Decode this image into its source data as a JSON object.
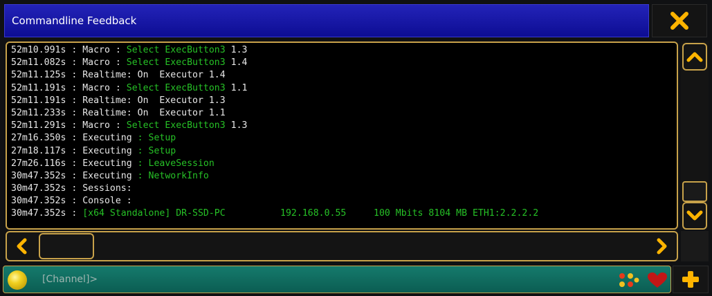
{
  "window": {
    "title": "Commandline Feedback",
    "close_icon": "close-x-icon"
  },
  "log": {
    "lines": [
      {
        "time": "52m10.991s",
        "sep": " : ",
        "word": "Macro : ",
        "green": "Select ExecButton3",
        "rest": " 1.3"
      },
      {
        "time": "52m11.082s",
        "sep": " : ",
        "word": "Macro : ",
        "green": "Select ExecButton3",
        "rest": " 1.4"
      },
      {
        "time": "52m11.125s",
        "sep": " : ",
        "word": "Realtime: On  Executor 1.4",
        "green": "",
        "rest": ""
      },
      {
        "time": "52m11.191s",
        "sep": " : ",
        "word": "Macro : ",
        "green": "Select ExecButton3",
        "rest": " 1.1"
      },
      {
        "time": "52m11.191s",
        "sep": " : ",
        "word": "Realtime: On  Executor 1.3",
        "green": "",
        "rest": ""
      },
      {
        "time": "52m11.233s",
        "sep": " : ",
        "word": "Realtime: On  Executor 1.1",
        "green": "",
        "rest": ""
      },
      {
        "time": "52m11.291s",
        "sep": " : ",
        "word": "Macro : ",
        "green": "Select ExecButton3",
        "rest": " 1.3"
      },
      {
        "time": "27m16.350s",
        "sep": " : ",
        "word": "Executing ",
        "green": ": Setup",
        "rest": ""
      },
      {
        "time": "27m18.117s",
        "sep": " : ",
        "word": "Executing ",
        "green": ": Setup",
        "rest": ""
      },
      {
        "time": "27m26.116s",
        "sep": " : ",
        "word": "Executing ",
        "green": ": LeaveSession",
        "rest": ""
      },
      {
        "time": "30m47.352s",
        "sep": " : ",
        "word": "Executing ",
        "green": ": NetworkInfo",
        "rest": ""
      },
      {
        "time": "30m47.352s",
        "sep": " : ",
        "word": "Sessions:",
        "green": "",
        "rest": ""
      },
      {
        "time": "30m47.352s",
        "sep": " : ",
        "word": "Console :",
        "green": "",
        "rest": ""
      },
      {
        "time": "30m47.352s",
        "sep": " : ",
        "word": "",
        "green": "[x64 Standalone] DR-SSD-PC          192.168.0.55     100 Mbits 8104 MB ETH1:2.2.2.2",
        "rest": ""
      }
    ]
  },
  "scroll": {
    "up_icon": "chevron-up-icon",
    "down_icon": "chevron-down-icon",
    "left_icon": "chevron-left-icon",
    "right_icon": "chevron-right-icon"
  },
  "commandline": {
    "prompt": "[Channel]>",
    "status_led_icon": "status-led-icon",
    "indicator_icons": [
      "executor-dots-icon",
      "heart-icon"
    ],
    "add_icon": "plus-icon"
  },
  "colors": {
    "titlebar": "#1515a8",
    "frame": "#c8a24a",
    "accent_orange": "#ffb400",
    "log_green": "#26c126",
    "cmdbar": "#0f6b5f"
  }
}
